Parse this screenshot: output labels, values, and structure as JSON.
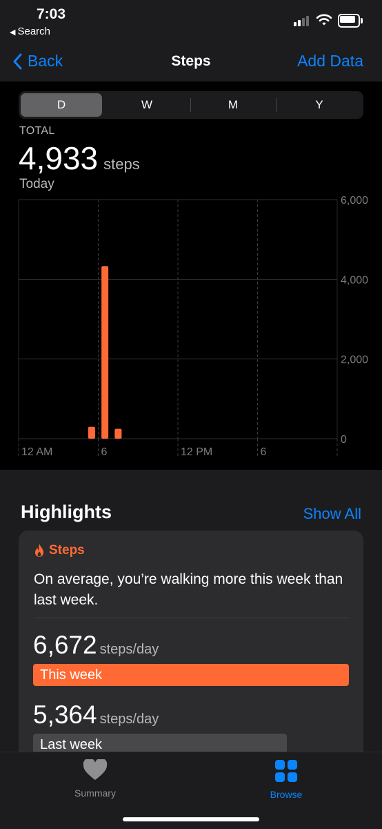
{
  "status_bar": {
    "time": "7:03",
    "back_app": "Search"
  },
  "nav": {
    "back_label": "Back",
    "title": "Steps",
    "action_label": "Add Data"
  },
  "segments": [
    "D",
    "W",
    "M",
    "Y"
  ],
  "selected_segment": "D",
  "summary": {
    "label": "TOTAL",
    "value": "4,933",
    "unit": "steps",
    "period": "Today"
  },
  "chart_data": {
    "type": "bar",
    "x_ticks": [
      "12 AM",
      "6",
      "12 PM",
      "6"
    ],
    "y_ticks": [
      "0",
      "2,000",
      "4,000",
      "6,000"
    ],
    "ylim": [
      0,
      6000
    ],
    "bar_color": "#ff6a34",
    "series": [
      {
        "values": [
          {
            "hour": 5,
            "steps": 300
          },
          {
            "hour": 6,
            "steps": 4330
          },
          {
            "hour": 7,
            "steps": 250
          }
        ]
      }
    ]
  },
  "highlights": {
    "heading": "Highlights",
    "show_all": "Show All",
    "card": {
      "category": "Steps",
      "message": "On average, you’re walking more this week than last week.",
      "this_week": {
        "value": "6,672",
        "unit": "steps/day",
        "label": "This week",
        "value_num": 6672,
        "color": "#ff6a34"
      },
      "last_week": {
        "value": "5,364",
        "unit": "steps/day",
        "label": "Last week",
        "value_num": 5364,
        "color": "#48484a"
      }
    }
  },
  "tabbar": {
    "summary": "Summary",
    "browse": "Browse",
    "active_color": "#0a84ff",
    "inactive_color": "#8e8e93"
  }
}
